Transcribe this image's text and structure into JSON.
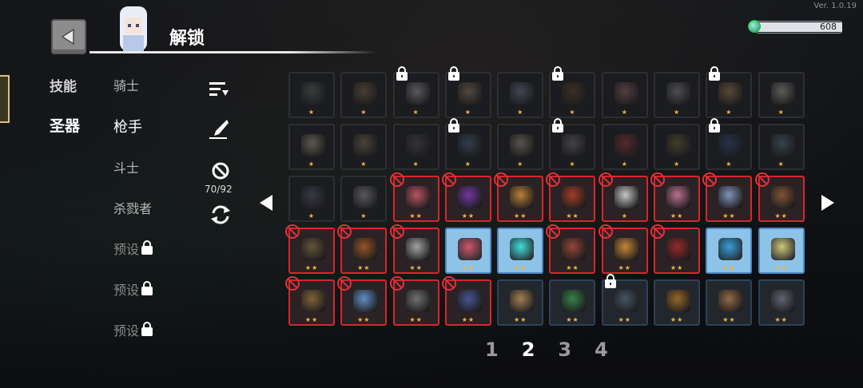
{
  "version": "Ver. 1.0.19",
  "currency": {
    "value": "608",
    "fill_fraction": 1.0,
    "icon": "gem-icon",
    "color": "#1d8a6a"
  },
  "header": {
    "title": "解锁",
    "back_icon": "back-arrow-icon"
  },
  "categories": [
    {
      "label": "技能",
      "active": false
    },
    {
      "label": "圣器",
      "active": true
    }
  ],
  "subcategories": [
    {
      "label": "骑士",
      "active": false,
      "locked": false
    },
    {
      "label": "枪手",
      "active": true,
      "locked": false
    },
    {
      "label": "斗士",
      "active": false,
      "locked": false
    },
    {
      "label": "杀戮者",
      "active": false,
      "locked": false
    },
    {
      "label": "预设",
      "active": false,
      "locked": true
    },
    {
      "label": "预设",
      "active": false,
      "locked": true
    },
    {
      "label": "预设",
      "active": false,
      "locked": true
    }
  ],
  "tools": {
    "sort_icon": "sort-icon",
    "edit_icon": "quill-icon",
    "forbid_icon": "forbid-icon",
    "forbid_count": "70/92",
    "refresh_icon": "refresh-icon"
  },
  "colors": {
    "forbidden": "#d7262b",
    "selected": "#8ec3e8",
    "star": "#f4b63a"
  },
  "relics": [
    {
      "stars": "★",
      "state": "dim",
      "lock": false,
      "art": "#6a7a70"
    },
    {
      "stars": "★",
      "state": "dim",
      "lock": false,
      "art": "#9a7a5a"
    },
    {
      "stars": "★",
      "state": "dim",
      "lock": true,
      "art": "#c8c8c8"
    },
    {
      "stars": "★",
      "state": "dim",
      "lock": true,
      "art": "#b89a7a"
    },
    {
      "stars": "★",
      "state": "dim",
      "lock": false,
      "art": "#8a94b0"
    },
    {
      "stars": "★",
      "state": "dim",
      "lock": true,
      "art": "#7a5030"
    },
    {
      "stars": "★",
      "state": "dim",
      "lock": false,
      "art": "#c07a80"
    },
    {
      "stars": "★",
      "state": "dim",
      "lock": false,
      "art": "#aaaaaa"
    },
    {
      "stars": "★",
      "state": "dim",
      "lock": true,
      "art": "#c89a5a"
    },
    {
      "stars": "★",
      "state": "dim",
      "lock": false,
      "art": "#d8d0c0"
    },
    {
      "stars": "★",
      "state": "dim",
      "lock": false,
      "art": "#d8c8a8"
    },
    {
      "stars": "★",
      "state": "dim",
      "lock": false,
      "art": "#a08a6a"
    },
    {
      "stars": "★",
      "state": "dim",
      "lock": false,
      "art": "#606060"
    },
    {
      "stars": "★",
      "state": "dim",
      "lock": true,
      "art": "#5a7a9a"
    },
    {
      "stars": "★",
      "state": "dim",
      "lock": false,
      "art": "#c8b89a"
    },
    {
      "stars": "★",
      "state": "dim",
      "lock": true,
      "art": "#8a8a8a"
    },
    {
      "stars": "★",
      "state": "dim",
      "lock": false,
      "art": "#c04040"
    },
    {
      "stars": "★",
      "state": "dim",
      "lock": false,
      "art": "#8a7a3a"
    },
    {
      "stars": "★",
      "state": "dim",
      "lock": true,
      "art": "#3a5a9a"
    },
    {
      "stars": "★",
      "state": "dim",
      "lock": false,
      "art": "#6a8a9a"
    },
    {
      "stars": "★",
      "state": "dim",
      "lock": false,
      "art": "#6a6a8a"
    },
    {
      "stars": "★",
      "state": "dim",
      "lock": false,
      "art": "#c8c8c8"
    },
    {
      "stars": "★★",
      "state": "forbidden",
      "lock": false,
      "art": "#c85a6a"
    },
    {
      "stars": "★★",
      "state": "forbidden",
      "lock": false,
      "art": "#7a3ab0"
    },
    {
      "stars": "★★",
      "state": "forbidden",
      "lock": false,
      "art": "#c88a3a"
    },
    {
      "stars": "★★",
      "state": "forbidden",
      "lock": false,
      "art": "#b0402a"
    },
    {
      "stars": "★",
      "state": "forbidden",
      "lock": false,
      "art": "#d8d8d8"
    },
    {
      "stars": "★★",
      "state": "forbidden",
      "lock": false,
      "art": "#c87a9a"
    },
    {
      "stars": "★★",
      "state": "forbidden",
      "lock": false,
      "art": "#8aa0c8"
    },
    {
      "stars": "★★",
      "state": "forbidden",
      "lock": false,
      "art": "#8a5a3a"
    },
    {
      "stars": "★★",
      "state": "forbidden",
      "lock": false,
      "art": "#6a5a3a"
    },
    {
      "stars": "★★",
      "state": "forbidden",
      "lock": false,
      "art": "#a05a2a"
    },
    {
      "stars": "★★",
      "state": "forbidden",
      "lock": false,
      "art": "#b0b0b0"
    },
    {
      "stars": "★★",
      "state": "selected",
      "lock": false,
      "art": "#d84a5a"
    },
    {
      "stars": "★★",
      "state": "selected",
      "lock": false,
      "art": "#3ae0d8"
    },
    {
      "stars": "★★",
      "state": "forbidden",
      "lock": false,
      "art": "#a04a3a"
    },
    {
      "stars": "★★",
      "state": "forbidden",
      "lock": false,
      "art": "#d8903a"
    },
    {
      "stars": "★★",
      "state": "forbidden",
      "lock": false,
      "art": "#a02a2a"
    },
    {
      "stars": "★★",
      "state": "selected",
      "lock": false,
      "art": "#2a9ad8"
    },
    {
      "stars": "★★",
      "state": "selected",
      "lock": false,
      "art": "#d8c86a"
    },
    {
      "stars": "★★",
      "state": "forbidden",
      "lock": false,
      "art": "#8a6a3a"
    },
    {
      "stars": "★★",
      "state": "forbidden",
      "lock": false,
      "art": "#6a9ad8"
    },
    {
      "stars": "★★",
      "state": "forbidden",
      "lock": false,
      "art": "#7a7a7a"
    },
    {
      "stars": "★★",
      "state": "forbidden",
      "lock": false,
      "art": "#4a5a9a"
    },
    {
      "stars": "★★",
      "state": "normal",
      "lock": false,
      "art": "#b08a5a"
    },
    {
      "stars": "★★",
      "state": "normal",
      "lock": false,
      "art": "#3a8a4a"
    },
    {
      "stars": "★★",
      "state": "normal",
      "lock": true,
      "art": "#4a5a6a"
    },
    {
      "stars": "★★",
      "state": "normal",
      "lock": false,
      "art": "#a0702a"
    },
    {
      "stars": "★★",
      "state": "normal",
      "lock": false,
      "art": "#a0704a"
    },
    {
      "stars": "★★",
      "state": "normal",
      "lock": false,
      "art": "#6a6a7a"
    }
  ],
  "pagination": {
    "pages": [
      "1",
      "2",
      "3",
      "4"
    ],
    "active_index": 1
  }
}
